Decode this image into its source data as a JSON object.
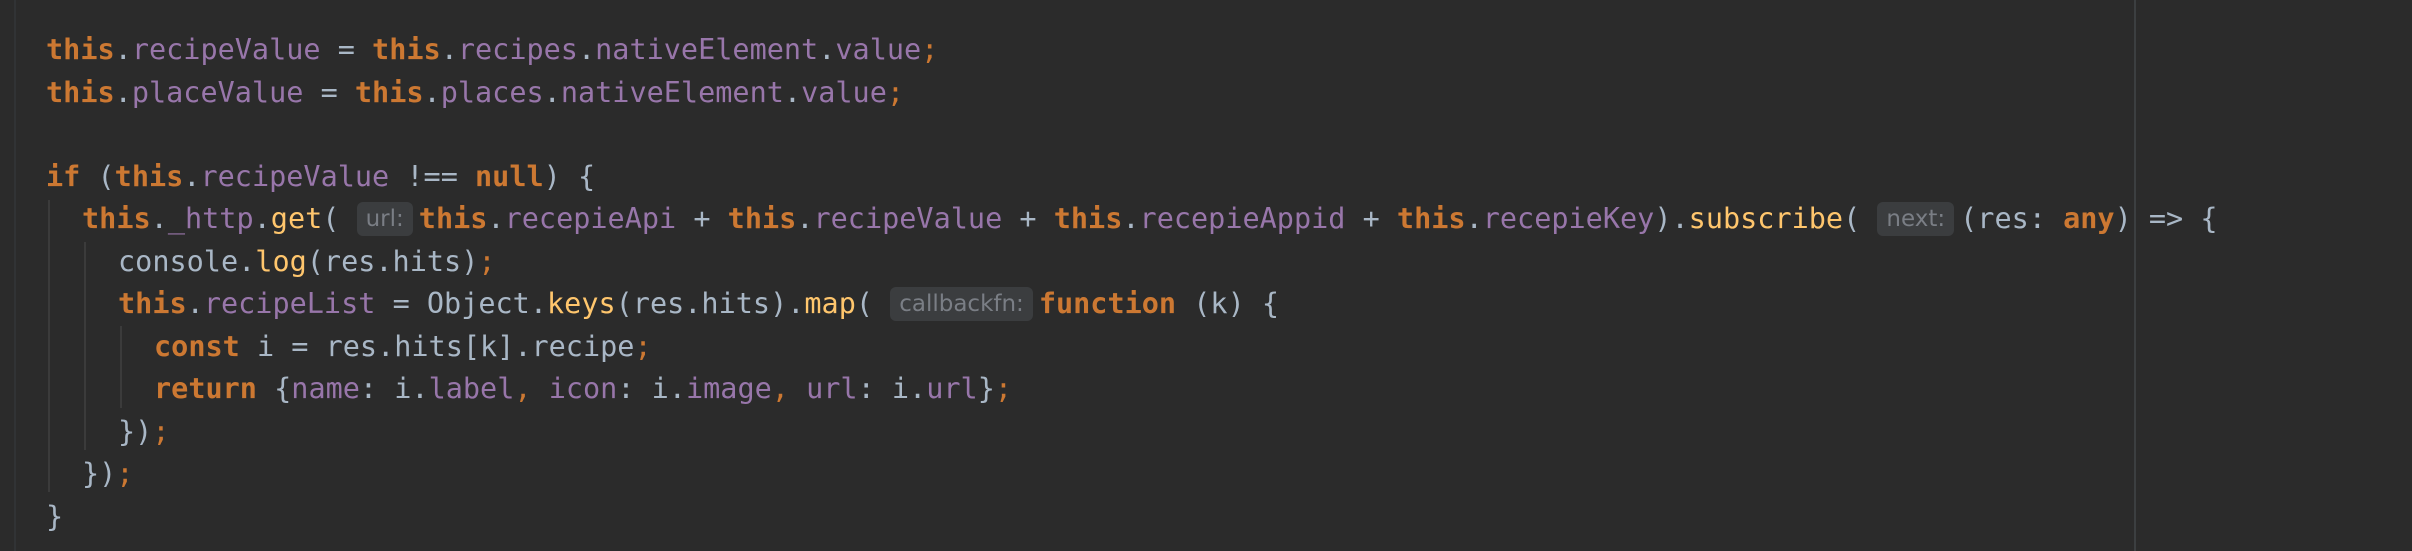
{
  "code": {
    "line1": {
      "kw_this_a": "this",
      "dot_a": ".",
      "fld_a": "recipeValue",
      "eq": " = ",
      "kw_this_b": "this",
      "dot_b": ".",
      "fld_b": "recipes",
      "dot_c": ".",
      "fld_c": "nativeElement",
      "dot_d": ".",
      "fld_d": "value",
      "semi": ";"
    },
    "line2": {
      "kw_this_a": "this",
      "dot_a": ".",
      "fld_a": "placeValue",
      "eq": " = ",
      "kw_this_b": "this",
      "dot_b": ".",
      "fld_b": "places",
      "dot_c": ".",
      "fld_c": "nativeElement",
      "dot_d": ".",
      "fld_d": "value",
      "semi": ";"
    },
    "line3": {
      "kw_if": "if",
      "paren_open": " (",
      "kw_this": "this",
      "dot": ".",
      "fld": "recipeValue",
      "op": " !== ",
      "kw_null": "null",
      "tail": ") {"
    },
    "line4": {
      "kw_this_a": "this",
      "dot_a": ".",
      "fld_http": "_http",
      "dot_b": ".",
      "fn_get": "get",
      "paren": "( ",
      "hint_url": "url:",
      "kw_this_b": "this",
      "dot_c": ".",
      "fld_api": "recepieApi",
      "plus_a": " + ",
      "kw_this_c": "this",
      "dot_d": ".",
      "fld_value": "recipeValue",
      "plus_b": " + ",
      "kw_this_d": "this",
      "dot_e": ".",
      "fld_appid": "recepieAppid",
      "plus_c": " + ",
      "kw_this_e": "this",
      "dot_f": ".",
      "fld_key": "recepieKey",
      "close_dot": ").",
      "fn_subscribe": "subscribe",
      "paren2": "( ",
      "hint_next": "next:",
      "params_open": "(res: ",
      "kw_any": "any",
      "arrow": ") => {"
    },
    "line5": {
      "obj": "console.",
      "fn_log": "log",
      "args": "(res.hits)",
      "semi": ";"
    },
    "line6": {
      "kw_this": "this",
      "dot_a": ".",
      "fld": "recipeList",
      "mid": " = Object.",
      "fn_keys": "keys",
      "args": "(res.hits).",
      "fn_map": "map",
      "paren": "( ",
      "hint_callback": "callbackfn:",
      "kw_function": "function",
      "tail": " (k) {"
    },
    "line7": {
      "kw_const": "const",
      "rest": " i = res.hits[k].recipe",
      "semi": ";"
    },
    "line8": {
      "kw_return": "return",
      "open": " {",
      "fld_name": "name",
      "colon_a": ": i.",
      "fld_label": "label",
      "comma_a": ", ",
      "fld_icon": "icon",
      "colon_b": ": i.",
      "fld_image": "image",
      "comma_b": ", ",
      "fld_url": "url",
      "colon_c": ": i.",
      "fld_url2": "url",
      "close": "}",
      "semi": ";"
    },
    "line9": {
      "close": "})",
      "semi": ";"
    },
    "line10": {
      "close": "})",
      "semi": ";"
    },
    "line11": {
      "close": "}"
    }
  },
  "colors": {
    "background": "#2b2b2b",
    "keyword": "#cc7832",
    "field": "#9876aa",
    "function": "#ffc66d",
    "text": "#a9b7c6",
    "hint": "#7a7e85"
  }
}
